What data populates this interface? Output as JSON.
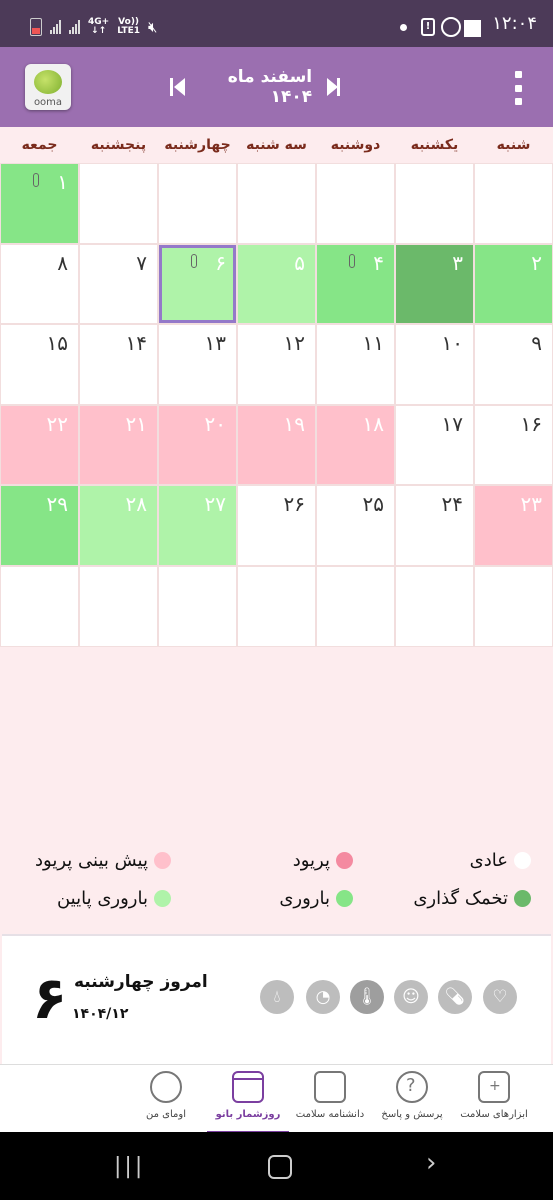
{
  "status_bar": {
    "time": "۱۲:۰۴",
    "network_top": "4G+",
    "network_bottom": "LTE1",
    "volte_top": "Vo))",
    "alarm_glyph": "!"
  },
  "header": {
    "logo_text": "ooma",
    "month_title": "اسفند ماه ۱۴۰۴"
  },
  "weekdays": [
    "شنبه",
    "یکشنبه",
    "دوشنبه",
    "سه شنبه",
    "چهارشنبه",
    "پنجشنبه",
    "جمعه"
  ],
  "calendar": {
    "cells": [
      {
        "day": "",
        "type": "empty"
      },
      {
        "day": "",
        "type": "empty"
      },
      {
        "day": "",
        "type": "empty"
      },
      {
        "day": "",
        "type": "empty"
      },
      {
        "day": "",
        "type": "empty"
      },
      {
        "day": "",
        "type": "empty"
      },
      {
        "day": "۱",
        "type": "fert",
        "note": true
      },
      {
        "day": "۲",
        "type": "fert"
      },
      {
        "day": "۳",
        "type": "ovul"
      },
      {
        "day": "۴",
        "type": "fert",
        "note": true
      },
      {
        "day": "۵",
        "type": "lowf"
      },
      {
        "day": "۶",
        "type": "lowf",
        "note": true,
        "today": true
      },
      {
        "day": "۷",
        "type": "normal"
      },
      {
        "day": "۸",
        "type": "normal"
      },
      {
        "day": "۹",
        "type": "normal"
      },
      {
        "day": "۱۰",
        "type": "normal"
      },
      {
        "day": "۱۱",
        "type": "normal"
      },
      {
        "day": "۱۲",
        "type": "normal"
      },
      {
        "day": "۱۳",
        "type": "normal"
      },
      {
        "day": "۱۴",
        "type": "normal"
      },
      {
        "day": "۱۵",
        "type": "normal"
      },
      {
        "day": "۱۶",
        "type": "normal"
      },
      {
        "day": "۱۷",
        "type": "normal"
      },
      {
        "day": "۱۸",
        "type": "pred"
      },
      {
        "day": "۱۹",
        "type": "pred"
      },
      {
        "day": "۲۰",
        "type": "pred"
      },
      {
        "day": "۲۱",
        "type": "pred"
      },
      {
        "day": "۲۲",
        "type": "pred"
      },
      {
        "day": "۲۳",
        "type": "pred"
      },
      {
        "day": "۲۴",
        "type": "normal"
      },
      {
        "day": "۲۵",
        "type": "normal"
      },
      {
        "day": "۲۶",
        "type": "normal"
      },
      {
        "day": "۲۷",
        "type": "lowf"
      },
      {
        "day": "۲۸",
        "type": "lowf"
      },
      {
        "day": "۲۹",
        "type": "fert"
      },
      {
        "day": "",
        "type": "empty"
      },
      {
        "day": "",
        "type": "empty"
      },
      {
        "day": "",
        "type": "empty"
      },
      {
        "day": "",
        "type": "empty"
      },
      {
        "day": "",
        "type": "empty"
      },
      {
        "day": "",
        "type": "empty"
      },
      {
        "day": "",
        "type": "empty"
      }
    ]
  },
  "legend": {
    "normal": "عادی",
    "period": "پریود",
    "predicted_period": "پیش بینی پریود",
    "ovulation": "تخمک گذاری",
    "fertile": "باروری",
    "low_fertile": "باروری پایین",
    "colors": {
      "normal": "#ffffff",
      "period": "#f48aa0",
      "predicted_period": "#ffc0cb",
      "ovulation": "#6bb96a",
      "fertile": "#86e587",
      "low_fertile": "#aff3a9"
    }
  },
  "today": {
    "day_number": "۶",
    "label": "امروز چهارشنبه",
    "date": "۱۴۰۴/۱۲",
    "tools": [
      "heart-icon",
      "pill-icon",
      "mood-face-icon",
      "thermometer-icon",
      "weight-scale-icon",
      "drop-icon"
    ]
  },
  "bottom_nav": [
    {
      "label": "ابزارهای سلامت",
      "icon": "first-aid-kit-icon"
    },
    {
      "label": "پرسش و پاسخ",
      "icon": "question-icon"
    },
    {
      "label": "دانشنامه سلامت",
      "icon": "newspaper-icon"
    },
    {
      "label": "روزشمار بانو",
      "icon": "calendar-icon",
      "active": true
    },
    {
      "label": "اومای من",
      "icon": "woman-avatar-icon"
    }
  ]
}
